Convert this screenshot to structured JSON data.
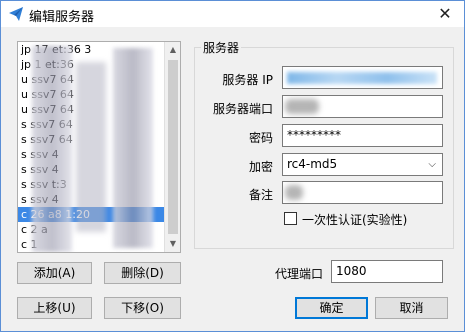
{
  "window": {
    "title": "编辑服务器",
    "close_glyph": "✕",
    "accent": "#0078d7"
  },
  "server_list": {
    "items": [
      "jp 17 et:36 3",
      "jp 1 et:36",
      "u ssv7 64",
      "u ssv7 64",
      "u ssv7 64",
      "s ssv7 64",
      "s ssv7 64",
      "s ssv 4",
      "s ssv 4",
      "s ssv t:3",
      "s ssv 4",
      "c 26 a8 1:20",
      "c 2 a",
      "c 1"
    ],
    "selected_index": 11
  },
  "buttons": {
    "add": "添加(A)",
    "delete": "删除(D)",
    "move_up": "上移(U)",
    "move_down": "下移(O)",
    "ok": "确定",
    "cancel": "取消"
  },
  "server_group": {
    "title": "服务器",
    "ip_label": "服务器 IP",
    "ip_value": "",
    "port_label": "服务器端口",
    "port_value": "",
    "password_label": "密码",
    "password_value": "*********",
    "encryption_label": "加密",
    "encryption_value": "rc4-md5",
    "remark_label": "备注",
    "remark_value": "",
    "onetime_auth_label": "一次性认证(实验性)",
    "onetime_auth_checked": false
  },
  "proxy": {
    "label": "代理端口",
    "value": "1080"
  }
}
